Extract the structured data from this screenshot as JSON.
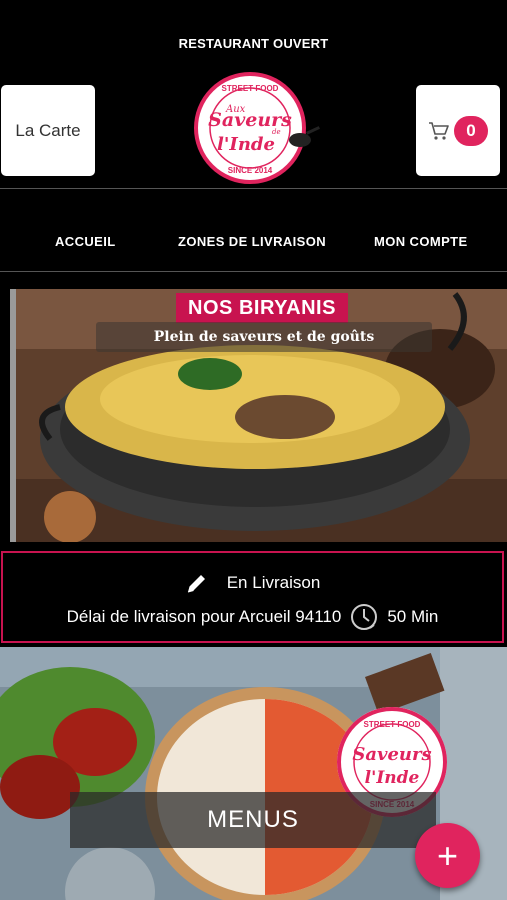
{
  "header": {
    "status_text": "RESTAURANT OUVERT",
    "menu_button_label": "La Carte",
    "cart_count": "0",
    "logo": {
      "top_text": "STREET FOOD",
      "line1": "Aux",
      "line2": "Saveurs",
      "line3": "de",
      "line4": "l'Inde",
      "bottom_text": "SINCE 2014"
    }
  },
  "nav": {
    "items": [
      "ACCUEIL",
      "ZONES DE LIVRAISON",
      "MON COMPTE"
    ]
  },
  "banner": {
    "title": "NOS BIRYANIS",
    "subtitle": "Plein de saveurs et de goûts"
  },
  "delivery": {
    "mode": "En Livraison",
    "delay_text": "Délai de livraison pour Arcueil 94110",
    "time": "50 Min"
  },
  "menus": {
    "label": "MENUS"
  },
  "fab": {
    "symbol": "+"
  },
  "colors": {
    "accent": "#e0245e",
    "banner_title_bg": "#c8134f",
    "background": "#000000"
  },
  "icons": [
    "cart-icon",
    "pencil-icon",
    "clock-icon",
    "plus-icon"
  ]
}
